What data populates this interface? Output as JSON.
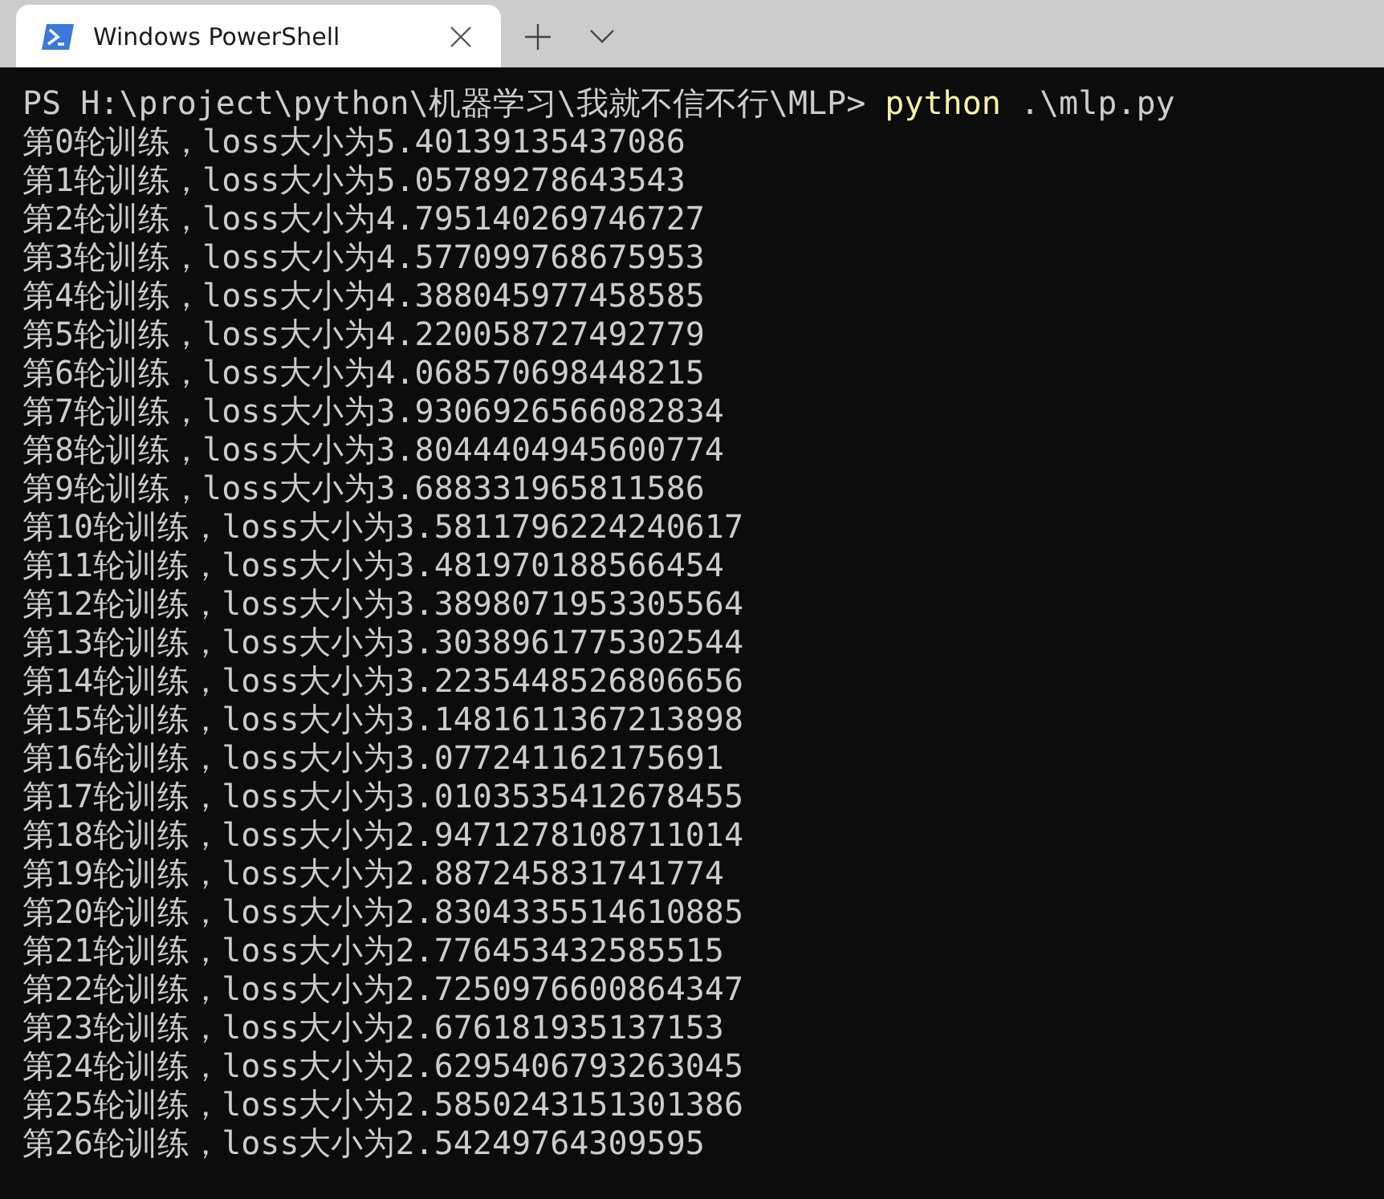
{
  "tabs": [
    {
      "title": "Windows PowerShell",
      "selected": true
    }
  ],
  "prompt": {
    "path": "PS H:\\project\\python\\机器学习\\我就不信不行\\MLP>",
    "command": "python",
    "arguments": ".\\mlp.py"
  },
  "output_lines": [
    "第0轮训练，loss大小为5.40139135437086",
    "第1轮训练，loss大小为5.05789278643543",
    "第2轮训练，loss大小为4.795140269746727",
    "第3轮训练，loss大小为4.577099768675953",
    "第4轮训练，loss大小为4.388045977458585",
    "第5轮训练，loss大小为4.220058727492779",
    "第6轮训练，loss大小为4.068570698448215",
    "第7轮训练，loss大小为3.9306926566082834",
    "第8轮训练，loss大小为3.8044404945600774",
    "第9轮训练，loss大小为3.688331965811586",
    "第10轮训练，loss大小为3.5811796224240617",
    "第11轮训练，loss大小为3.481970188566454",
    "第12轮训练，loss大小为3.3898071953305564",
    "第13轮训练，loss大小为3.3038961775302544",
    "第14轮训练，loss大小为3.2235448526806656",
    "第15轮训练，loss大小为3.1481611367213898",
    "第16轮训练，loss大小为3.077241162175691",
    "第17轮训练，loss大小为3.0103535412678455",
    "第18轮训练，loss大小为2.9471278108711014",
    "第19轮训练，loss大小为2.887245831741774",
    "第20轮训练，loss大小为2.8304335514610885",
    "第21轮训练，loss大小为2.776453432585515",
    "第22轮训练，loss大小为2.7250976600864347",
    "第23轮训练，loss大小为2.676181935137153",
    "第24轮训练，loss大小为2.6295406793263045",
    "第25轮训练，loss大小为2.5850243151301386",
    "第26轮训练，loss大小为2.54249764309595"
  ]
}
